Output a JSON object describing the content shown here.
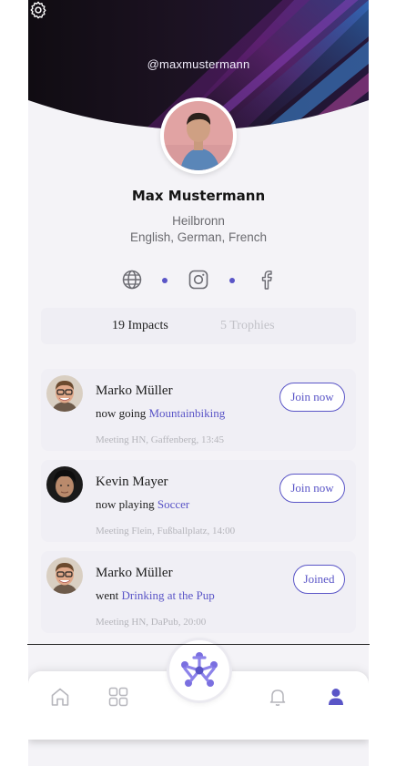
{
  "profile": {
    "handle": "@maxmustermann",
    "name": "Max Mustermann",
    "city": "Heilbronn",
    "languages": "English, German, French"
  },
  "socials": {
    "icons": [
      "globe-icon",
      "instagram-icon",
      "facebook-icon"
    ]
  },
  "stats": {
    "impacts": "19 Impacts",
    "trophies": "5 Trophies"
  },
  "feed": [
    {
      "name": "Marko Müller",
      "verb": "now going",
      "activity": "Mountainbiking",
      "meta": "Meeting HN, Gaffenberg, 13:45",
      "button": "Join now"
    },
    {
      "name": "Kevin Mayer",
      "verb": "now playing",
      "activity": "Soccer",
      "meta": "Meeting Flein, Fußballplatz, 14:00",
      "button": "Join now"
    },
    {
      "name": "Marko Müller",
      "verb": "went",
      "activity": "Drinking at the Pup",
      "meta": "Meeting HN, DaPub, 20:00",
      "button": "Joined"
    }
  ],
  "nav": {
    "items": [
      "home-icon",
      "grid-icon",
      "app-logo",
      "bell-icon",
      "profile-icon"
    ]
  },
  "colors": {
    "accent": "#5a55c7",
    "header_dark": "#14101c",
    "background": "#f4f3f7"
  }
}
